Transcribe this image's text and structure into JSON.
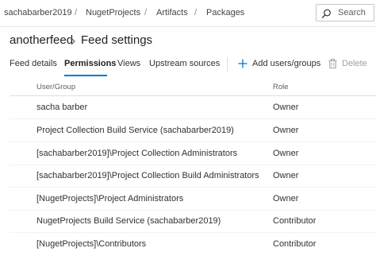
{
  "breadcrumb": {
    "items": [
      "sachabarber2019",
      "NugetProjects",
      "Artifacts",
      "Packages"
    ],
    "separator": "/"
  },
  "search": {
    "placeholder": "Search",
    "icon": "search-icon"
  },
  "header": {
    "feed_name": "anotherfeed",
    "page_title": "Feed settings"
  },
  "tabs": [
    {
      "label": "Feed details",
      "active": false
    },
    {
      "label": "Permissions",
      "active": true
    },
    {
      "label": "Views",
      "active": false
    },
    {
      "label": "Upstream sources",
      "active": false
    }
  ],
  "commands": {
    "add_label": "Add users/groups",
    "delete_label": "Delete"
  },
  "table": {
    "columns": [
      "User/Group",
      "Role"
    ],
    "rows": [
      {
        "user": "sacha barber",
        "role": "Owner"
      },
      {
        "user": "Project Collection Build Service (sachabarber2019)",
        "role": "Owner"
      },
      {
        "user": "[sachabarber2019]\\Project Collection Administrators",
        "role": "Owner"
      },
      {
        "user": "[sachabarber2019]\\Project Collection Build Administrators",
        "role": "Owner"
      },
      {
        "user": "[NugetProjects]\\Project Administrators",
        "role": "Owner"
      },
      {
        "user": "NugetProjects Build Service (sachabarber2019)",
        "role": "Contributor"
      },
      {
        "user": "[NugetProjects]\\Contributors",
        "role": "Contributor"
      }
    ]
  },
  "colors": {
    "accent": "#0078d4",
    "text": "#323130",
    "muted": "#605e5c"
  }
}
